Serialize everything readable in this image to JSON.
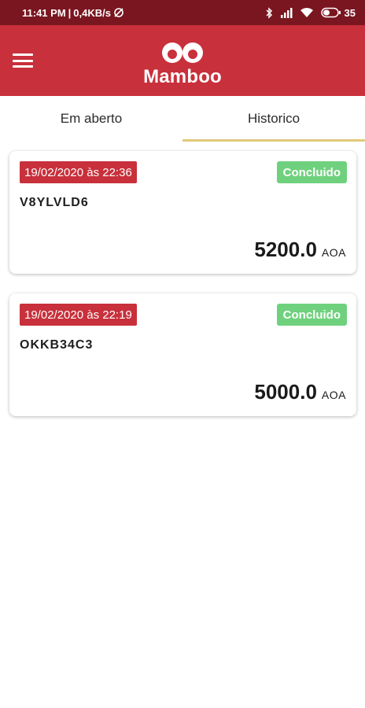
{
  "statusbar": {
    "time": "11:41 PM",
    "separator": "|",
    "speed": "0,4KB/s",
    "battery": "35",
    "icons": [
      "sync-off-icon",
      "bluetooth-icon",
      "signal-icon",
      "wifi-icon",
      "battery-icon"
    ]
  },
  "appbar": {
    "logo_text": "Mamboo",
    "menu_icon": "hamburger-menu-icon"
  },
  "tabs": [
    {
      "label": "Em aberto",
      "active": false
    },
    {
      "label": "Historico",
      "active": true
    }
  ],
  "orders": [
    {
      "date": "19/02/2020 às 22:36",
      "status": "Concluido",
      "code": "V8YLVLD6",
      "amount": "5200.0",
      "currency": "AOA"
    },
    {
      "date": "19/02/2020 às 22:19",
      "status": "Concluido",
      "code": "OKKB34C3",
      "amount": "5000.0",
      "currency": "AOA"
    }
  ],
  "colors": {
    "statusbar": "#7a1620",
    "appbar": "#c8303b",
    "tab_indicator": "#e1c97a",
    "status_done": "#6fd17d"
  }
}
